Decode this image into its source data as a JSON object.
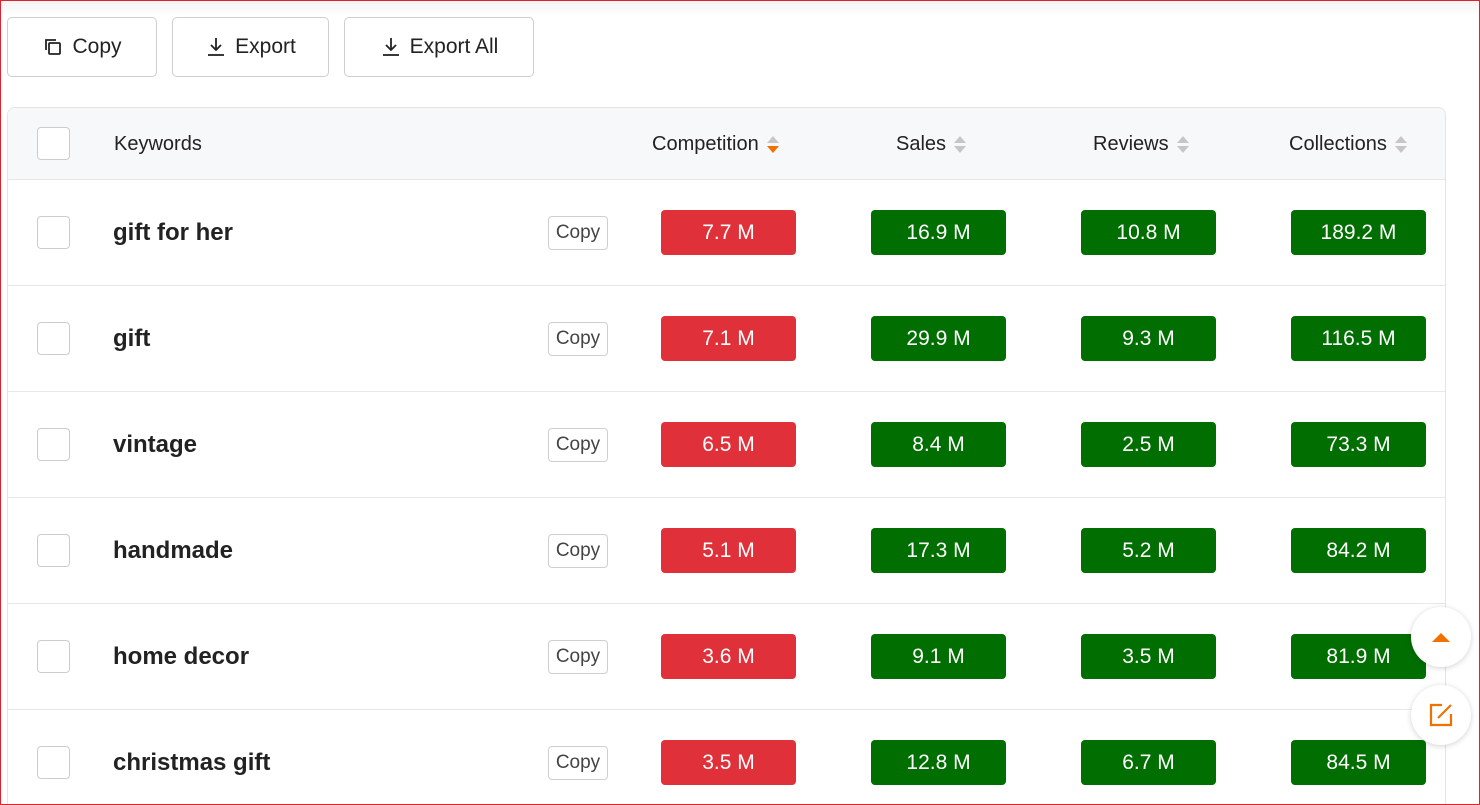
{
  "toolbar": {
    "copy_label": "Copy",
    "export_label": "Export",
    "export_all_label": "Export All"
  },
  "table": {
    "headers": {
      "keywords": "Keywords",
      "competition": "Competition",
      "sales": "Sales",
      "reviews": "Reviews",
      "collections": "Collections"
    },
    "sorted_column": "competition",
    "sort_direction": "descending",
    "row_copy_label": "Copy",
    "rows": [
      {
        "keyword": "gift for her",
        "competition": "7.7 M",
        "sales": "16.9 M",
        "reviews": "10.8 M",
        "collections": "189.2 M"
      },
      {
        "keyword": "gift",
        "competition": "7.1 M",
        "sales": "29.9 M",
        "reviews": "9.3 M",
        "collections": "116.5 M"
      },
      {
        "keyword": "vintage",
        "competition": "6.5 M",
        "sales": "8.4 M",
        "reviews": "2.5 M",
        "collections": "73.3 M"
      },
      {
        "keyword": "handmade",
        "competition": "5.1 M",
        "sales": "17.3 M",
        "reviews": "5.2 M",
        "collections": "84.2 M"
      },
      {
        "keyword": "home decor",
        "competition": "3.6 M",
        "sales": "9.1 M",
        "reviews": "3.5 M",
        "collections": "81.9 M"
      },
      {
        "keyword": "christmas gift",
        "competition": "3.5 M",
        "sales": "12.8 M",
        "reviews": "6.7 M",
        "collections": "84.5 M"
      }
    ]
  },
  "colors": {
    "competition_badge": "#e0303a",
    "metric_badge": "#006e00",
    "accent": "#f07000"
  },
  "icons": {
    "copy": "copy-icon",
    "export": "download-icon",
    "scroll_top": "arrow-up-icon",
    "feedback": "edit-icon"
  }
}
